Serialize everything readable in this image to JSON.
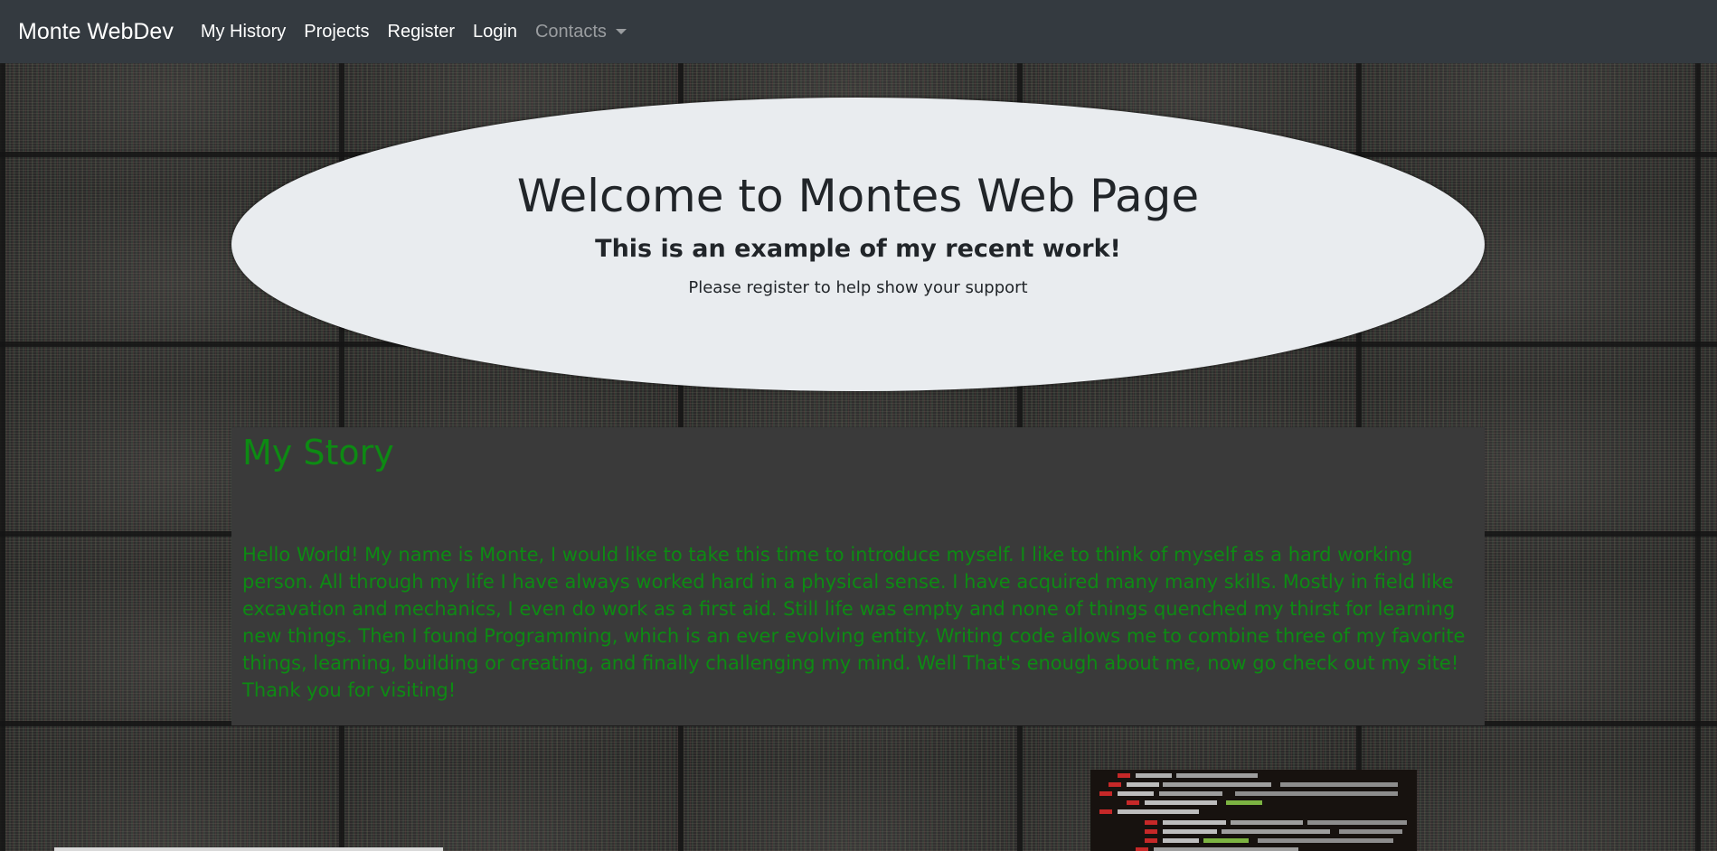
{
  "navbar": {
    "brand": "Monte WebDev",
    "links": [
      {
        "label": "My History"
      },
      {
        "label": "Projects"
      },
      {
        "label": "Register"
      },
      {
        "label": "Login"
      },
      {
        "label": "Contacts",
        "has_dropdown": true
      }
    ]
  },
  "hero": {
    "title": "Welcome to Montes Web Page",
    "subtitle": "This is an example of my recent work!",
    "text": "Please register to help show your support"
  },
  "story": {
    "title": "My Story",
    "body": "Hello World! My name is Monte, I would like to take this time to introduce myself. I like to think of myself as a hard working person. All through my life I have always worked hard in a physical sense. I have acquired many many skills. Mostly in field like excavation and mechanics, I even do work as a first aid. Still life was empty and none of things quenched my thirst for learning new things. Then I found Programming, which is an ever evolving entity. Writing code allows me to combine three of my favorite things, learning, building or creating, and finally challenging my mind. Well That's enough about me, now go check out my site! Thank you for visiting!"
  },
  "colors": {
    "navbar_bg": "#343a40",
    "hero_bg": "#e9ecef",
    "story_bg": "#3a3a3a",
    "story_text": "#0d8a13",
    "contacts_muted": "#9a9da0"
  }
}
